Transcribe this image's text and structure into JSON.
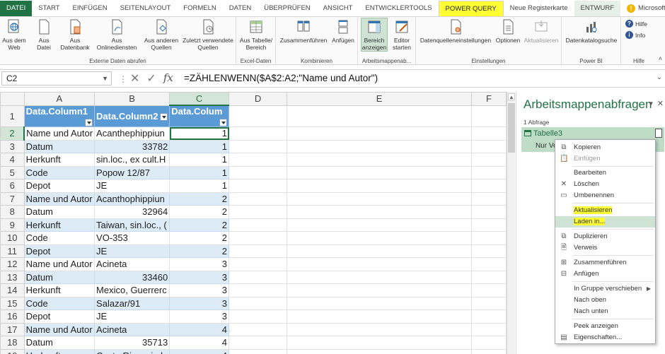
{
  "tabs": [
    "DATEI",
    "START",
    "EINFÜGEN",
    "SEITENLAYOUT",
    "FORMELN",
    "DATEN",
    "ÜBERPRÜFEN",
    "ANSICHT",
    "ENTWICKLERTOOLS",
    "POWER QUERY",
    "Neue Registerkarte",
    "ENTWURF"
  ],
  "account": "Microsoft-Konto",
  "ribbon": {
    "from_web": "Aus dem Web",
    "from_file": "Aus Datei",
    "from_db": "Aus Datenbank",
    "from_online": "Aus Onlinediensten",
    "from_other": "Aus anderen Quellen",
    "recent": "Zuletzt verwendete Quellen",
    "group_external": "Externe Daten abrufen",
    "from_table": "Aus Tabelle/ Bereich",
    "group_excel": "Excel-Daten",
    "merge": "Zusammenführen",
    "append": "Anfügen",
    "group_combine": "Kombinieren",
    "show_pane_1": "Bereich",
    "show_pane_2": "anzeigen",
    "editor_1": "Editor",
    "editor_2": "starten",
    "group_workbook": "Arbeitsmappenab...",
    "ds_settings": "Datenquelleneinstellungen",
    "options": "Optionen",
    "updates": "Aktualisieren",
    "group_settings": "Einstellungen",
    "data_catalog": "Datenkatalogsuche",
    "group_powerbi": "Power BI",
    "help": "Hilfe",
    "info": "Info",
    "group_help": "Hilfe"
  },
  "formula_bar": {
    "namebox": "C2",
    "formula": "=ZÄHLENWENN($A$2:A2;\"Name und Autor\")"
  },
  "grid": {
    "columns": [
      "A",
      "B",
      "C",
      "D",
      "E",
      "F"
    ],
    "header_row": [
      "Data.Column1",
      "Data.Column2",
      "Data.Colum"
    ],
    "rows": [
      {
        "n": "2",
        "a": "Name und Autor",
        "b": "Acanthephippiun",
        "c": "1"
      },
      {
        "n": "3",
        "a": "Datum",
        "b": "33782",
        "c": "1"
      },
      {
        "n": "4",
        "a": "Herkunft",
        "b": "sin.loc., ex cult.H",
        "c": "1"
      },
      {
        "n": "5",
        "a": "Code",
        "b": "Popow 12/87",
        "c": "1"
      },
      {
        "n": "6",
        "a": "Depot",
        "b": "JE",
        "c": "1"
      },
      {
        "n": "7",
        "a": "Name und Autor",
        "b": "Acanthophippiun",
        "c": "2"
      },
      {
        "n": "8",
        "a": "Datum",
        "b": "32964",
        "c": "2"
      },
      {
        "n": "9",
        "a": "Herkunft",
        "b": "Taiwan, sin.loc., (",
        "c": "2"
      },
      {
        "n": "10",
        "a": "Code",
        "b": "VO-353",
        "c": "2"
      },
      {
        "n": "11",
        "a": "Depot",
        "b": "JE",
        "c": "2"
      },
      {
        "n": "12",
        "a": "Name und Autor",
        "b": "Acineta",
        "c": "3"
      },
      {
        "n": "13",
        "a": "Datum",
        "b": "33460",
        "c": "3"
      },
      {
        "n": "14",
        "a": "Herkunft",
        "b": "Mexico, Guerrerc",
        "c": "3"
      },
      {
        "n": "15",
        "a": "Code",
        "b": "Salazar/91",
        "c": "3"
      },
      {
        "n": "16",
        "a": "Depot",
        "b": "JE",
        "c": "3"
      },
      {
        "n": "17",
        "a": "Name und Autor",
        "b": "Acineta",
        "c": "4"
      },
      {
        "n": "18",
        "a": "Datum",
        "b": "35713",
        "c": "4"
      },
      {
        "n": "19",
        "a": "Herkunft",
        "b": "Costa Rica, sin.lo",
        "c": "4"
      }
    ]
  },
  "pane": {
    "title": "Arbeitsmappenabfragen",
    "count": "1 Abfrage",
    "query_name": "Tabelle3",
    "query_sub": "Nur Ve"
  },
  "menu": {
    "copy": "Kopieren",
    "paste": "Einfügen",
    "edit": "Bearbeiten",
    "delete": "Löschen",
    "rename": "Umbenennen",
    "refresh": "Aktualisieren",
    "load_to": "Laden in...",
    "duplicate": "Duplizieren",
    "reference": "Verweis",
    "merge": "Zusammenführen",
    "append": "Anfügen",
    "move_to_group": "In Gruppe verschieben",
    "move_up": "Nach oben",
    "move_down": "Nach unten",
    "show_peek": "Peek anzeigen",
    "properties": "Eigenschaften..."
  },
  "colors": {
    "excel_green": "#217346",
    "highlight_yellow": "#ffff33",
    "table_header_blue": "#5b9bd5",
    "table_band_blue": "#ddebf7"
  }
}
